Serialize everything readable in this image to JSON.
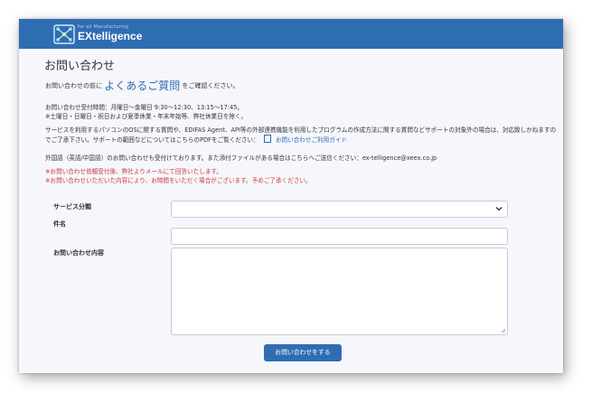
{
  "header": {
    "brand_tagline": "for all Manufacturing",
    "brand_name": "EXtelligence",
    "brand_color": "#2f6db3"
  },
  "page": {
    "title": "お問い合わせ",
    "intro_before": "お問い合わせの前に",
    "faq_link": "よくあるご質問",
    "intro_after": "をご確認ください。",
    "hours_line1": "お問い合わせ受付時間：月曜日～金曜日 9:30～12:30、13:15～17:45。",
    "hours_line2": "※土曜日・日曜日・祝日および夏季休業・年末年始等、弊社休業日を除く。",
    "notice": "サービスを利用するパソコンのOSに関する質問や、EDIFAS Agent、API等の外部連携機能を利用したプログラムの作成方法に関する質問などサポートの対象外の場合は、対応致しかねますのでご了承下さい。サポートの範囲などについてはこちらのPDFをご覧ください：",
    "guide_link": "お問い合わせご利用ガイド",
    "foreign_language": "外国語（英語/中国語）のお問い合わせも受付けております。また添付ファイルがある場合はこちらへご送信ください：ex-telligence@xeex.co.jp",
    "warning1": "※お問い合わせ依頼受付後、弊社よりメールにて回答いたします。",
    "warning2": "※お問い合わせいただいた内容により、お時間をいただく場合がございます。予めご了承ください。",
    "warning_color": "#cc3b3b"
  },
  "form": {
    "service_label": "サービス分類",
    "service_value": "",
    "subject_label": "件名",
    "subject_value": "",
    "content_label": "お問い合わせ内容",
    "content_value": "",
    "submit_label": "お問い合わせをする"
  }
}
